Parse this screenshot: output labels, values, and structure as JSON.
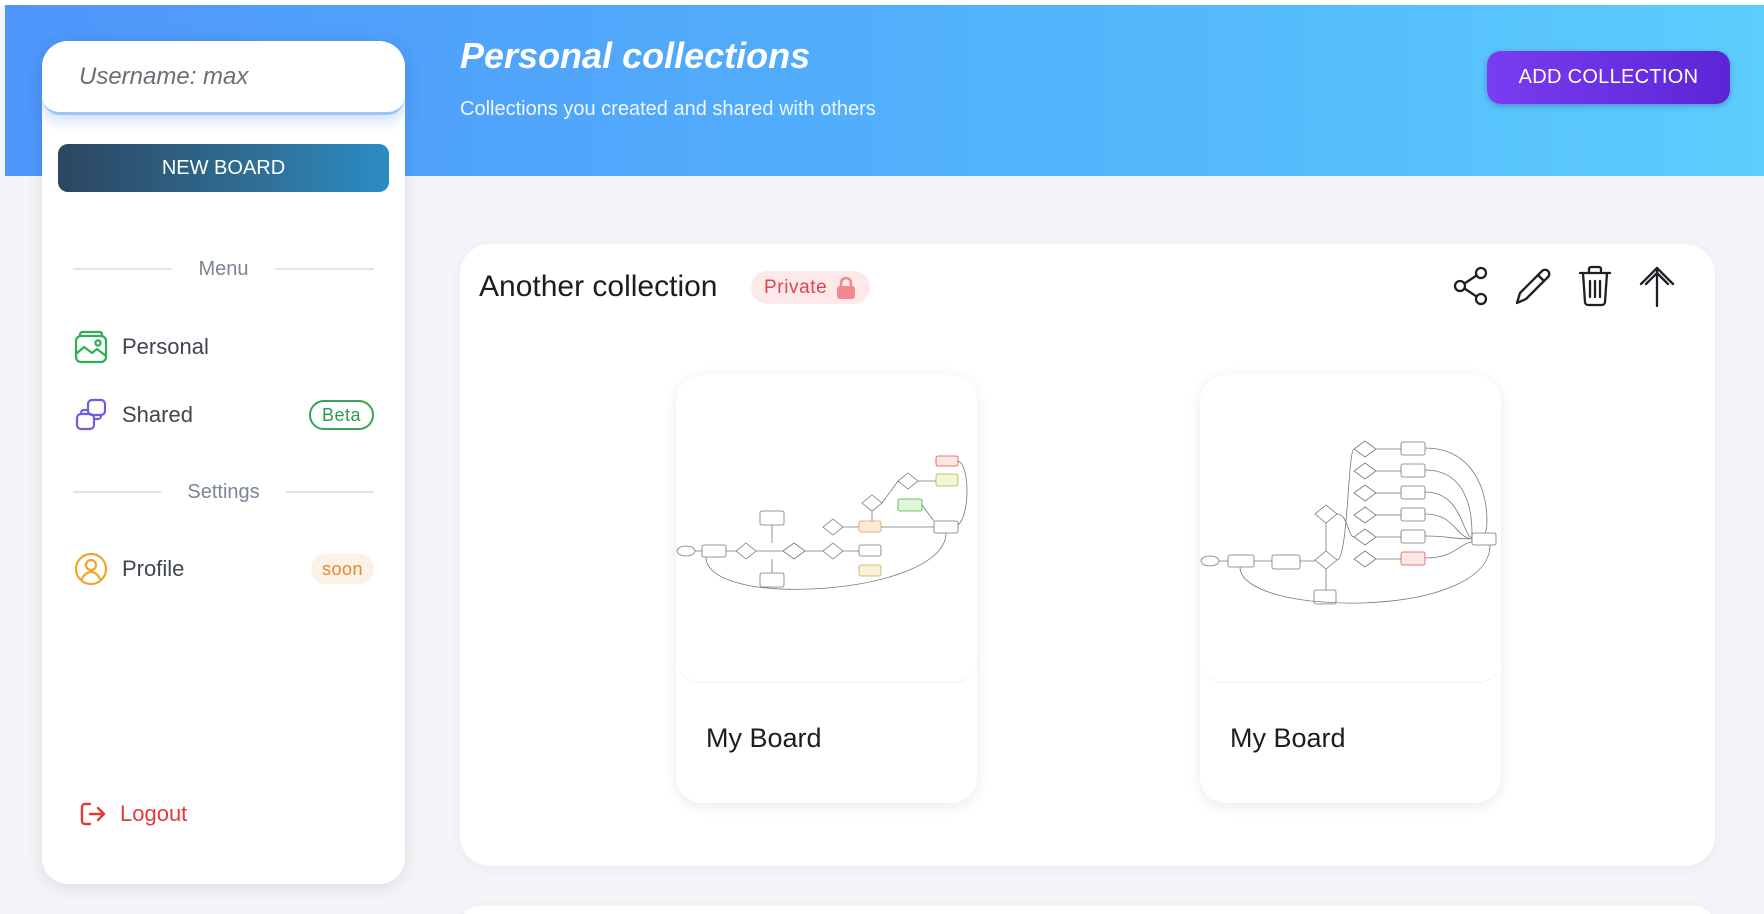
{
  "header": {
    "title": "Personal collections",
    "subtitle": "Collections you created and shared with others",
    "add_button": "ADD COLLECTION",
    "gradient": [
      "#4f96fb",
      "#5ccdfc"
    ]
  },
  "sidebar": {
    "username": "Username: max",
    "new_board": "NEW BOARD",
    "menu_header": "Menu",
    "settings_header": "Settings",
    "items": [
      {
        "label": "Personal",
        "icon": "gallery-icon",
        "color": "#2fae52"
      },
      {
        "label": "Shared",
        "icon": "shared-copy-icon",
        "color": "#6b5fe0",
        "badge": "Beta"
      },
      {
        "label": "Profile",
        "icon": "user-circle-icon",
        "color": "#f0a52a",
        "badge": "soon"
      }
    ],
    "logout": "Logout"
  },
  "collection": {
    "title": "Another collection",
    "visibility": "Private",
    "actions": [
      "share-icon",
      "edit-icon",
      "trash-icon",
      "move-up-icon"
    ],
    "boards": [
      {
        "name": "My Board",
        "thumbnail": "flowchart-preview"
      },
      {
        "name": "My Board",
        "thumbnail": "flowchart-preview"
      }
    ]
  }
}
